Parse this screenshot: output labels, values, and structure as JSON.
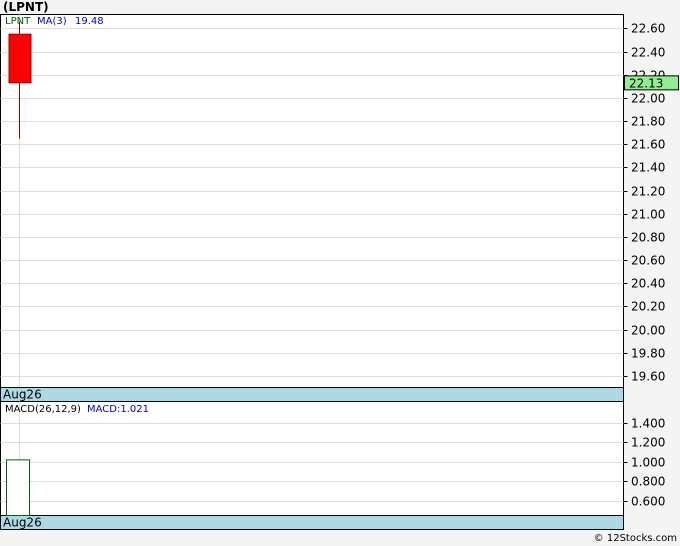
{
  "title": "(LPNT)",
  "copyright": "© 12Stocks.com",
  "colors": {
    "grid": "#bdbdbd",
    "candle_down": "#ff0000",
    "wick": "#990000",
    "date_band": "#add8e6",
    "price_badge_bg": "#90ee90",
    "legend_ticker": "#006400",
    "legend_ma": "#0000cc",
    "macd_bar_stroke": "#006400"
  },
  "chart_data": [
    {
      "name": "price",
      "type": "candlestick",
      "legend": {
        "ticker": "LPNT",
        "ma_label": "MA(3)",
        "ma_value": "19.48"
      },
      "x_label": "Aug26",
      "last_price_label": "22.13",
      "ylim": [
        19.5,
        22.72
      ],
      "y_ticks": [
        "22.60",
        "22.40",
        "22.20",
        "22.00",
        "21.80",
        "21.60",
        "21.40",
        "21.20",
        "21.00",
        "20.80",
        "20.60",
        "20.40",
        "20.20",
        "20.00",
        "19.80",
        "19.60"
      ],
      "candles": [
        {
          "date": "Aug26",
          "open": 22.55,
          "high": 22.66,
          "low": 21.65,
          "close": 22.13
        }
      ]
    },
    {
      "name": "macd",
      "type": "bar",
      "legend": {
        "params": "MACD(26,12,9)",
        "value_label": "MACD:1.021"
      },
      "x_label": "Aug26",
      "ylim": [
        0.45,
        1.62
      ],
      "y_ticks": [
        "1.400",
        "1.200",
        "1.000",
        "0.800",
        "0.600"
      ],
      "values": [
        1.021
      ]
    }
  ]
}
